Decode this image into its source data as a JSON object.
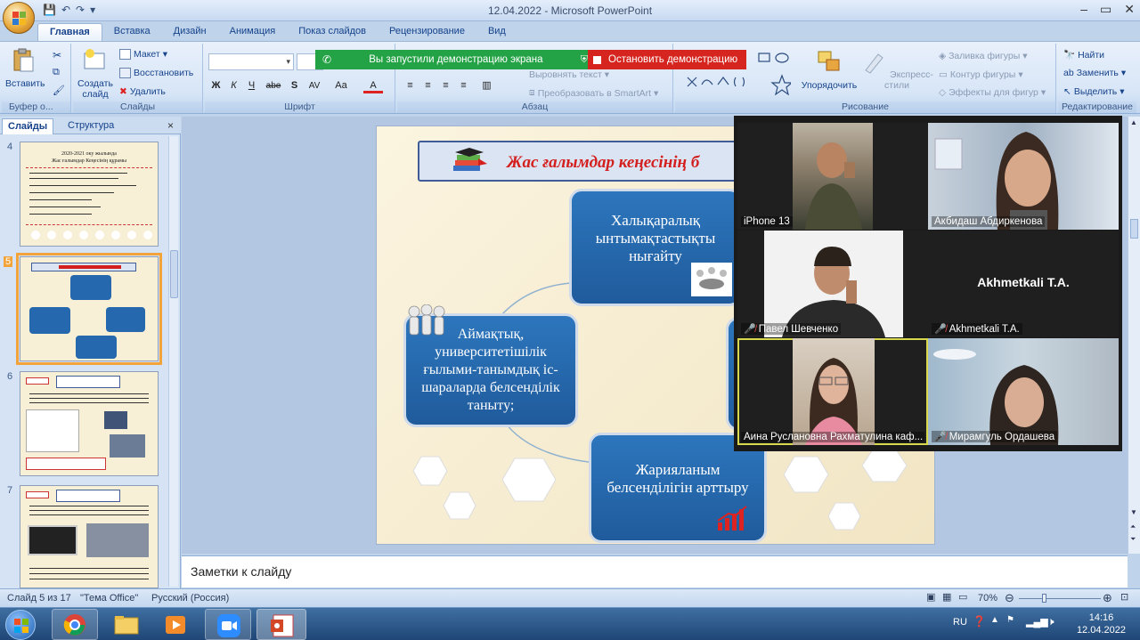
{
  "window": {
    "title": "12.04.2022 - Microsoft PowerPoint"
  },
  "ribbon": {
    "tabs": [
      "Главная",
      "Вставка",
      "Дизайн",
      "Анимация",
      "Показ слайдов",
      "Рецензирование",
      "Вид"
    ],
    "active_tab": "Главная",
    "clipboard": {
      "paste": "Вставить",
      "label": "Буфер о..."
    },
    "slides": {
      "create": "Создать слайд",
      "create_line1": "Создать",
      "create_line2": "слайд",
      "layout": "Макет",
      "reset": "Восстановить",
      "delete": "Удалить",
      "label": "Слайды"
    },
    "font": {
      "label": "Шрифт",
      "bold": "Ж",
      "italic": "К",
      "underline": "Ч",
      "strike": "abe",
      "shadow": "S",
      "spacing": "AV",
      "case": "Aa",
      "color": "A"
    },
    "paragraph": {
      "label": "Абзац",
      "align_text": "Выровнять текст",
      "smartart": "Преобразовать в SmartArt"
    },
    "drawing": {
      "arrange": "Упорядочить",
      "quick_styles": "Экспресс-стили",
      "fill": "Заливка фигуры",
      "outline": "Контур фигуры",
      "effects": "Эффекты для фигур",
      "label": "Рисование"
    },
    "editing": {
      "find": "Найти",
      "replace": "Заменить",
      "select": "Выделить",
      "label": "Редактирование"
    }
  },
  "share_banner": {
    "message": "Вы запустили демонстрацию экрана",
    "stop": "Остановить демонстрацию",
    "green": "#24a246",
    "red": "#d6251f"
  },
  "left_pane": {
    "tabs": [
      "Слайды",
      "Структура"
    ],
    "close": "×",
    "thumbnails": [
      {
        "num": "4",
        "title_line1": "2020-2021 оку жылында",
        "title_line2": "Жас ғалымдар Кеңесінің құрамы"
      },
      {
        "num": "5",
        "selected": true
      },
      {
        "num": "6"
      },
      {
        "num": "7"
      }
    ]
  },
  "slide": {
    "title": "Жас ғалымдар кеңесінің б",
    "nodes": {
      "top": "Халықаралық ынтымақтастықты нығайту",
      "left": "Аймақтық, университетішілік ғылыми-танымдық іс-шараларда белсенділік таныту;",
      "bottom": "Жарияланым белсенділігін арттыру"
    }
  },
  "notes": {
    "placeholder": "Заметки к слайду"
  },
  "status": {
    "slide": "Слайд 5 из 17",
    "theme": "\"Тема Office\"",
    "language": "Русский (Россия)",
    "zoom": "70%"
  },
  "zoom_participants": [
    {
      "name": "iPhone 13",
      "muted": false,
      "video": true
    },
    {
      "name": "Акбидаш Абдиркенова",
      "muted": false,
      "video": true
    },
    {
      "name": "Павел Шевченко",
      "muted": true,
      "video": true
    },
    {
      "name": "Akhmetkali T.A.",
      "muted": true,
      "video": false
    },
    {
      "name": "Аина Руслановна Рахматулина каф...",
      "muted": false,
      "video": true,
      "active": true
    },
    {
      "name": "Мирамгуль Ордашева",
      "muted": true,
      "video": true
    }
  ],
  "taskbar": {
    "lang": "RU",
    "time": "14:16",
    "date": "12.04.2022"
  }
}
